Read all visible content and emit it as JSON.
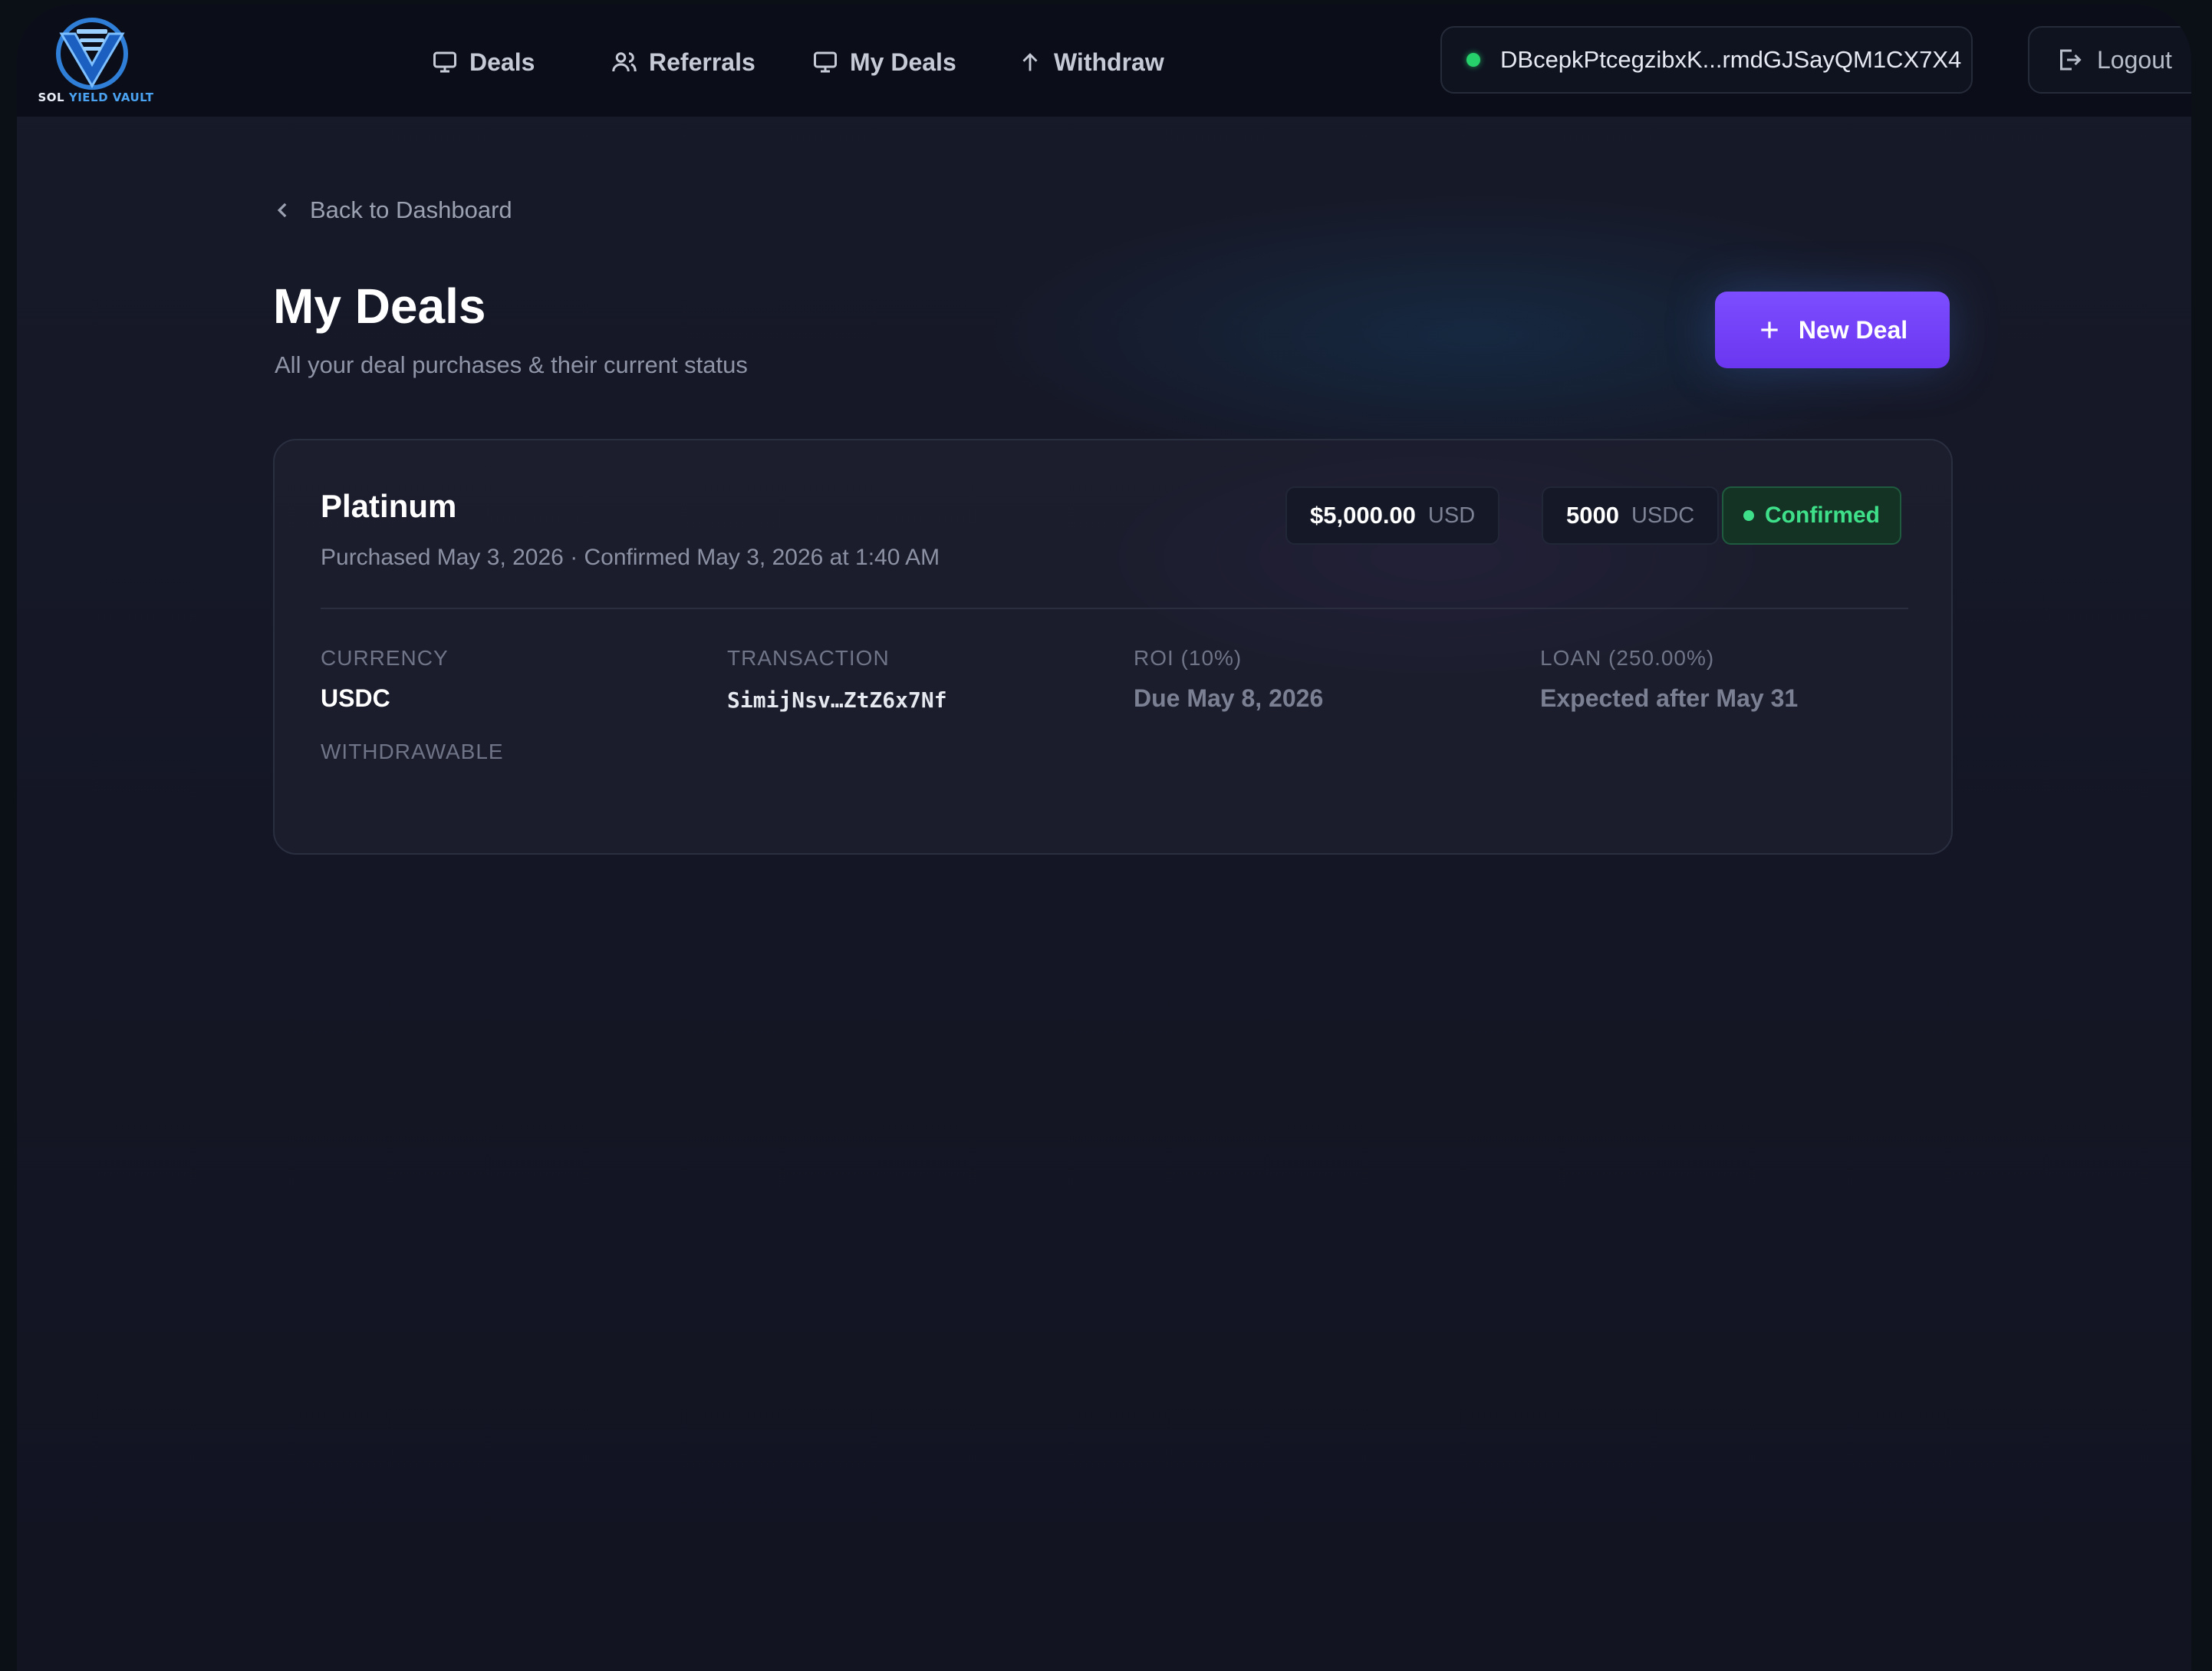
{
  "brand": {
    "logo_text_a": "SOL",
    "logo_text_b": " YIELD VAULT"
  },
  "nav": {
    "items": [
      {
        "label": "Deals",
        "icon": "monitor-icon"
      },
      {
        "label": "Referrals",
        "icon": "users-icon"
      },
      {
        "label": "My Deals",
        "icon": "monitor-icon"
      },
      {
        "label": "Withdraw",
        "icon": "arrow-up-icon"
      }
    ],
    "wallet": "DBcepkPtcegzibxK...rmdGJSayQM1CX7X4",
    "logout": "Logout"
  },
  "page": {
    "back_label": "Back to Dashboard",
    "title": "My Deals",
    "subtitle": "All your deal purchases & their current status",
    "new_deal_label": "New Deal"
  },
  "deal": {
    "name": "Platinum",
    "meta": "Purchased May 3, 2026 · Confirmed May 3, 2026 at 1:40 AM",
    "usd_amount": "$5,000.00",
    "usd_unit": "USD",
    "token_amount": "5000",
    "token_unit": "USDC",
    "status": "Confirmed",
    "fields": {
      "currency_label": "CURRENCY",
      "currency_value": "USDC",
      "transaction_label": "TRANSACTION",
      "transaction_value": "SimijNsv…ZtZ6x7Nf",
      "roi_label": "ROI (10%)",
      "roi_value": "Due May 8, 2026",
      "loan_label": "LOAN (250.00%)",
      "loan_value": "Expected after May 31",
      "withdrawable_label": "WITHDRAWABLE"
    }
  },
  "colors": {
    "accent": "#6b36f0",
    "status_green": "#3fe08a",
    "background": "#141625"
  }
}
